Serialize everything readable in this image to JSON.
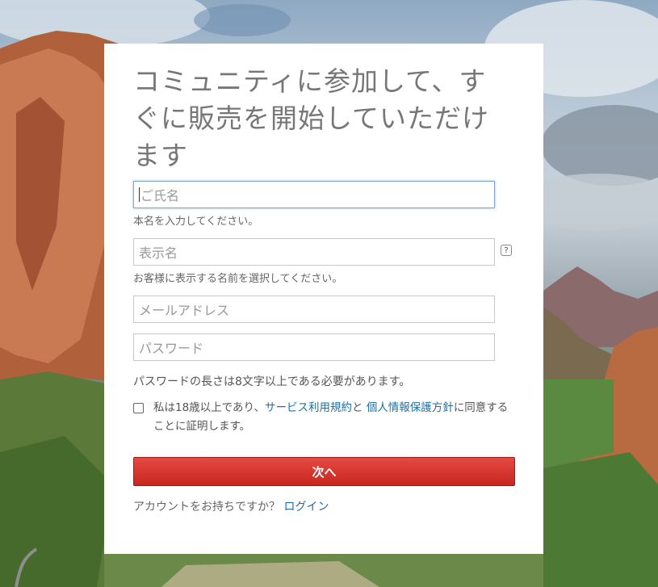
{
  "form": {
    "title": "コミュニティに参加して、すぐに販売を開始していただけます",
    "full_name": {
      "value": "",
      "placeholder": "ご氏名",
      "hint": "本名を入力してください。"
    },
    "display_name": {
      "value": "",
      "placeholder": "表示名",
      "hint": "お客様に表示する名前を選択してください。",
      "help_icon": "?"
    },
    "email": {
      "value": "",
      "placeholder": "メールアドレス"
    },
    "password": {
      "value": "",
      "placeholder": "パスワード",
      "rule": "パスワードの長さは8文字以上である必要があります。"
    },
    "agreement": {
      "checked": false,
      "text_before": "私は18歳以上であり、",
      "terms_link": "サービス利用規約",
      "text_and": "と ",
      "privacy_link": "個人情報保護方針",
      "text_after": "に同意することに証明します。"
    },
    "next_button": "次へ",
    "login_prompt": "アカウントをお持ちですか？",
    "login_link": "ログイン"
  },
  "colors": {
    "button_red": "#c7261f",
    "link_blue": "#1f6fa3",
    "title_gray": "#777777"
  }
}
